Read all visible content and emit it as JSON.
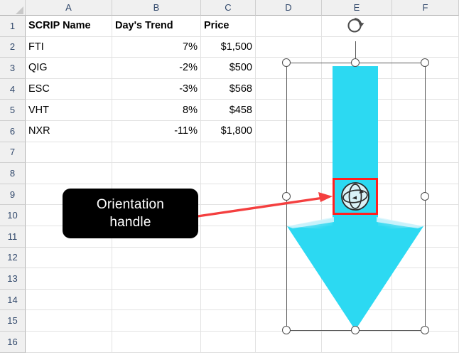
{
  "app": {
    "type": "spreadsheet",
    "accent_cyan": "#2cd9f2",
    "annotation_red": "#ff2020",
    "callout_bg": "#000000",
    "callout_fg": "#ffffff"
  },
  "grid": {
    "column_headers": [
      "A",
      "B",
      "C",
      "D",
      "E",
      "F"
    ],
    "row_headers": [
      "1",
      "2",
      "3",
      "4",
      "5",
      "6",
      "7",
      "8",
      "9",
      "10",
      "11",
      "12",
      "13",
      "14",
      "15",
      "16"
    ],
    "select_all_icon": "select-all-corner"
  },
  "table": {
    "header_row": [
      "SCRIP Name",
      "Day's Trend",
      "Price"
    ],
    "rows": [
      {
        "scrip": "FTI",
        "trend": "7%",
        "price": "$1,500"
      },
      {
        "scrip": "QIG",
        "trend": "-2%",
        "price": "$500"
      },
      {
        "scrip": "ESC",
        "trend": "-3%",
        "price": "$568"
      },
      {
        "scrip": "VHT",
        "trend": "8%",
        "price": "$458"
      },
      {
        "scrip": "NXR",
        "trend": "-11%",
        "price": "$1,800"
      }
    ]
  },
  "shape": {
    "name": "down-arrow-shape",
    "fill": "#2cd9f2",
    "selected": true,
    "rotate_handle_icon": "rotate-handle-icon",
    "orientation_handle_icon": "orientation-3d-handle-icon",
    "resize_handle_icon": "resize-handle-icon"
  },
  "annotation": {
    "callout_line1": "Orientation",
    "callout_line2": "handle",
    "pointer_icon": "red-arrow-pointer",
    "highlight_icon": "red-highlight-box"
  }
}
